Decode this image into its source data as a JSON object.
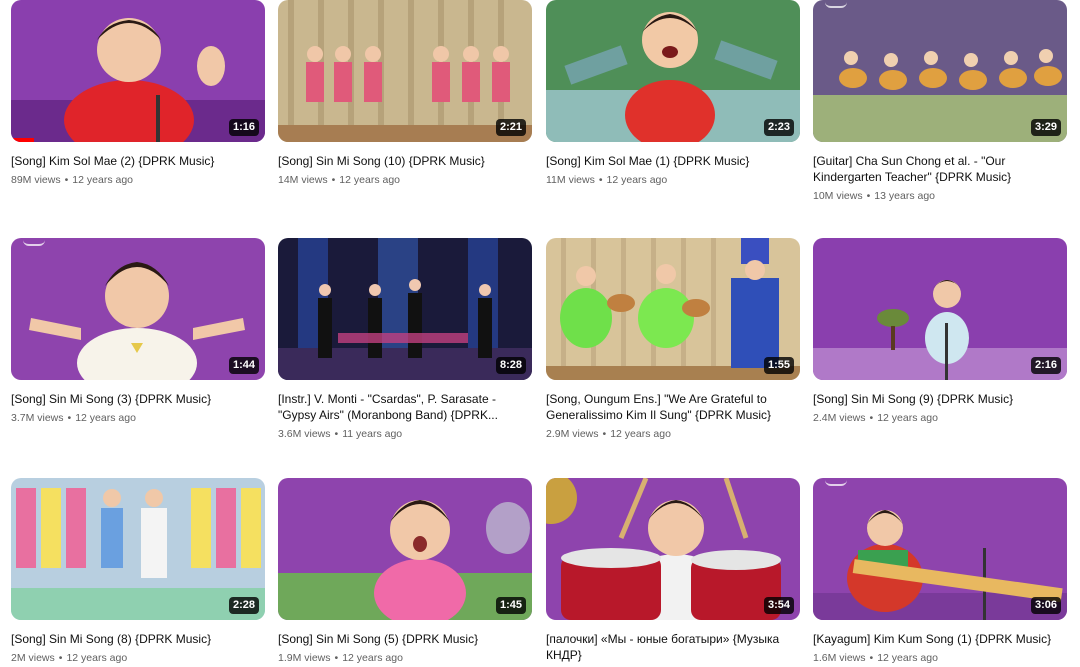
{
  "videos": [
    {
      "title": "[Song] Kim Sol Mae (2) {DPRK Music}",
      "views": "89M views",
      "age": "12 years ago",
      "duration": "1:16",
      "watched_fraction": 0.09
    },
    {
      "title": "[Song] Sin Mi Song (10) {DPRK Music}",
      "views": "14M views",
      "age": "12 years ago",
      "duration": "2:21"
    },
    {
      "title": "[Song] Kim Sol Mae (1) {DPRK Music}",
      "views": "11M views",
      "age": "12 years ago",
      "duration": "2:23"
    },
    {
      "title": "[Guitar] Cha Sun Chong et al. - \"Our Kindergarten Teacher\" {DPRK Music}",
      "views": "10M views",
      "age": "13 years ago",
      "duration": "3:29"
    },
    {
      "title": "[Song] Sin Mi Song (3) {DPRK Music}",
      "views": "3.7M views",
      "age": "12 years ago",
      "duration": "1:44"
    },
    {
      "title": "[Instr.] V. Monti - \"Csardas\", P. Sarasate - \"Gypsy Airs\" (Moranbong Band) {DPRK...",
      "views": "3.6M views",
      "age": "11 years ago",
      "duration": "8:28"
    },
    {
      "title": "[Song, Oungum Ens.] \"We Are Grateful to Generalissimo Kim Il Sung\" {DPRK Music}",
      "views": "2.9M views",
      "age": "12 years ago",
      "duration": "1:55"
    },
    {
      "title": "[Song] Sin Mi Song (9) {DPRK Music}",
      "views": "2.4M views",
      "age": "12 years ago",
      "duration": "2:16"
    },
    {
      "title": "[Song] Sin Mi Song (8) {DPRK Music}",
      "views": "2M views",
      "age": "12 years ago",
      "duration": "2:28"
    },
    {
      "title": "[Song] Sin Mi Song (5) {DPRK Music}",
      "views": "1.9M views",
      "age": "12 years ago",
      "duration": "1:45"
    },
    {
      "title": "[палочки] «Мы - юные богатыри» {Музыка КНДР}",
      "views": "",
      "age": "",
      "duration": "3:54"
    },
    {
      "title": "[Kayagum] Kim Kum Song (1) {DPRK Music}",
      "views": "1.6M views",
      "age": "12 years ago",
      "duration": "3:06"
    }
  ],
  "colors": {
    "progress": "#ff0000",
    "meta_text": "#606060"
  }
}
